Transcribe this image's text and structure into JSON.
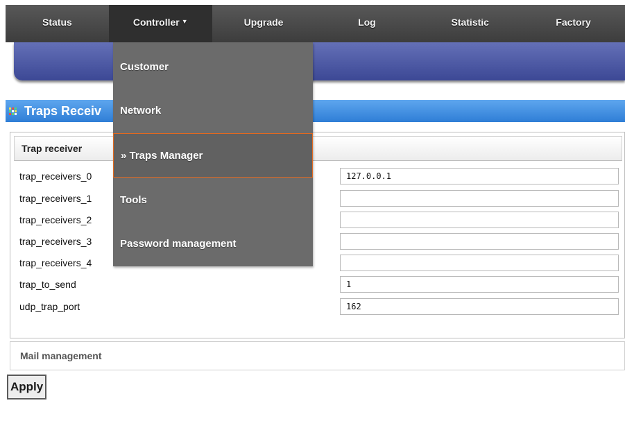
{
  "nav": {
    "items": [
      {
        "label": "Status"
      },
      {
        "label": "Controller",
        "caret": "▼"
      },
      {
        "label": "Upgrade"
      },
      {
        "label": "Log"
      },
      {
        "label": "Statistic"
      },
      {
        "label": "Factory"
      }
    ]
  },
  "dropdown": {
    "items": [
      {
        "label": "Customer"
      },
      {
        "label": "Network"
      },
      {
        "label": "» Traps Manager"
      },
      {
        "label": "Tools"
      },
      {
        "label": "Password management"
      }
    ]
  },
  "section": {
    "title": "Traps Receiv",
    "icon": "colored-grid-icon"
  },
  "panel": {
    "header": "Trap receiver",
    "rows": [
      {
        "label": "trap_receivers_0",
        "value": "127.0.0.1"
      },
      {
        "label": "trap_receivers_1",
        "value": ""
      },
      {
        "label": "trap_receivers_2",
        "value": ""
      },
      {
        "label": "trap_receivers_3",
        "value": ""
      },
      {
        "label": "trap_receivers_4",
        "value": ""
      },
      {
        "label": "trap_to_send",
        "value": "1"
      },
      {
        "label": "udp_trap_port",
        "value": "162"
      }
    ]
  },
  "mail": {
    "label": "Mail management"
  },
  "apply": {
    "label": "Apply"
  },
  "colors": {
    "nav_bg": "#4a4a4a",
    "band_blue": "#4a56a4",
    "title_blue": "#3d8fe3",
    "dropdown_bg": "#6b6b6b",
    "active_border": "#e2691f"
  }
}
